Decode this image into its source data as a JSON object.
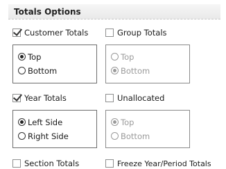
{
  "header": {
    "title": "Totals Options"
  },
  "customer_totals": {
    "label": "Customer Totals",
    "checked": true
  },
  "group_totals": {
    "label": "Group Totals",
    "checked": false
  },
  "customer_position": {
    "options": [
      "Top",
      "Bottom"
    ],
    "selected": "Top",
    "enabled": true
  },
  "group_position": {
    "options": [
      "Top",
      "Bottom"
    ],
    "selected": "Bottom",
    "enabled": false
  },
  "year_totals": {
    "label": "Year Totals",
    "checked": true
  },
  "unallocated": {
    "label": "Unallocated",
    "checked": false
  },
  "year_position": {
    "options": [
      "Left Side",
      "Right Side"
    ],
    "selected": "Left Side",
    "enabled": true
  },
  "unallocated_position": {
    "options": [
      "Top",
      "Bottom"
    ],
    "selected": "Top",
    "enabled": false
  },
  "section_totals": {
    "label": "Section Totals",
    "checked": false
  },
  "freeze_totals": {
    "label": "Freeze Year/Period Totals",
    "checked": false
  }
}
